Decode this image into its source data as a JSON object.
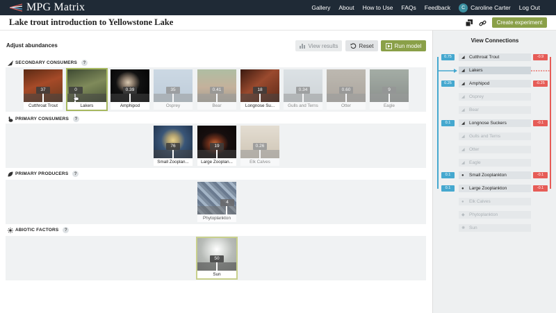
{
  "app": {
    "title": "MPG Matrix"
  },
  "nav": {
    "gallery": "Gallery",
    "about": "About",
    "how": "How to Use",
    "faqs": "FAQs",
    "feedback": "Feedback",
    "avatar": "C",
    "user": "Caroline Carter",
    "logout": "Log Out"
  },
  "page": {
    "title": "Lake trout introduction to Yellowstone Lake",
    "create": "Create experiment"
  },
  "controls": {
    "adjust": "Adjust abundances",
    "view_results": "View results",
    "reset": "Reset",
    "run": "Run model"
  },
  "sections": {
    "secondary": {
      "title": "SECONDARY CONSUMERS",
      "help": "?"
    },
    "primary": {
      "title": "PRIMARY CONSUMERS",
      "help": "?"
    },
    "producers": {
      "title": "PRIMARY PRODUCERS",
      "help": "?"
    },
    "abiotic": {
      "title": "ABIOTIC FACTORS",
      "help": "?"
    }
  },
  "cards": {
    "secondary": [
      {
        "name": "Cutthroat Trout",
        "value": "37",
        "color": "#7a3a20"
      },
      {
        "name": "Lakers",
        "value": "0",
        "color": "#6d7a4d"
      },
      {
        "name": "Amphipod",
        "value": "0.39",
        "color": "#1a1a1a"
      },
      {
        "name": "Osprey",
        "value": "35",
        "color": "#9fb4c8"
      },
      {
        "name": "Bear",
        "value": "0.41",
        "color": "#8a6a44"
      },
      {
        "name": "Longnose Su...",
        "value": "18",
        "color": "#7a3a28"
      },
      {
        "name": "Gulls and Terns",
        "value": "0.34",
        "color": "#b9c2c8"
      },
      {
        "name": "Otter",
        "value": "0.60",
        "color": "#7d7160"
      },
      {
        "name": "Eagle",
        "value": "9",
        "color": "#3a4a3a"
      }
    ],
    "primary": [
      {
        "name": "Small Zooplan...",
        "value": "76",
        "color": "#3d5a7a"
      },
      {
        "name": "Large Zooplan...",
        "value": "19",
        "color": "#2a1e1e"
      },
      {
        "name": "Elk Calves",
        "value": "0.26",
        "color": "#c8b49a"
      }
    ],
    "producers": [
      {
        "name": "Phytoplankton",
        "value": "4",
        "color": "#5a6e86"
      }
    ],
    "abiotic": [
      {
        "name": "Sun",
        "value": "50",
        "color": "#c9ccc9"
      }
    ]
  },
  "connections": {
    "title": "View Connections",
    "species": [
      {
        "name": "Cutthroat Trout",
        "icon": "fish",
        "left": "0.75",
        "right": "-0.9"
      },
      {
        "name": "Lakers",
        "icon": "fish",
        "left": "",
        "right": ""
      },
      {
        "name": "Amphipod",
        "icon": "fish",
        "left": "0.25",
        "right": "-0.25"
      },
      {
        "name": "Osprey",
        "icon": "fish",
        "left": "",
        "right": ""
      },
      {
        "name": "Bear",
        "icon": "fish",
        "left": "",
        "right": ""
      },
      {
        "name": "Longnose Suckers",
        "icon": "fish",
        "left": "0.1",
        "right": "-0.1"
      },
      {
        "name": "Gulls and Terns",
        "icon": "fish",
        "left": "",
        "right": ""
      },
      {
        "name": "Otter",
        "icon": "fish",
        "left": "",
        "right": ""
      },
      {
        "name": "Eagle",
        "icon": "fish",
        "left": "",
        "right": ""
      },
      {
        "name": "Small Zooplankton",
        "icon": "rabbit",
        "left": "0.1",
        "right": "-0.1"
      },
      {
        "name": "Large Zooplankton",
        "icon": "rabbit",
        "left": "0.1",
        "right": "-0.1"
      },
      {
        "name": "Elk Calves",
        "icon": "rabbit",
        "left": "",
        "right": ""
      },
      {
        "name": "Phytoplankton",
        "icon": "leaf",
        "left": "",
        "right": ""
      },
      {
        "name": "Sun",
        "icon": "sun",
        "left": "",
        "right": ""
      }
    ]
  },
  "colors": {
    "accent": "#8aa048",
    "positive": "#45a8cf",
    "negative": "#e65c57",
    "topbar": "#1f2a36"
  }
}
